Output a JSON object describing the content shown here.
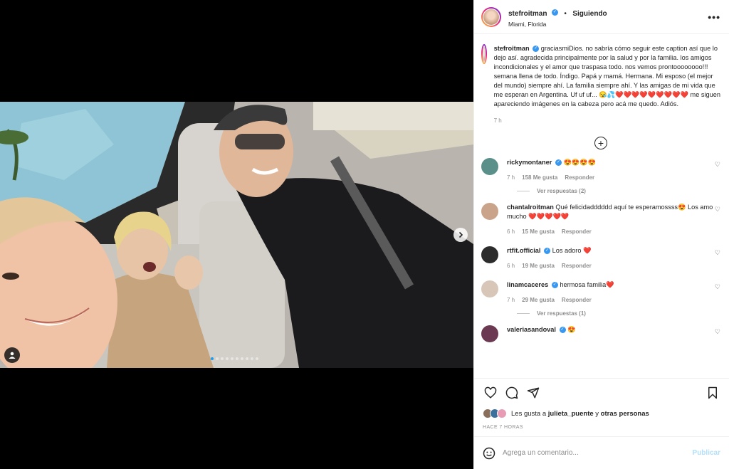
{
  "post": {
    "username": "stefroitman",
    "follow_status": "Siguiendo",
    "location": "Miami, Florida",
    "more": "•••",
    "caption": "graciasmiDios. no sabría cómo seguir este caption así que lo dejo así. agradecida principalmente por la salud y por la familia. los amigos incondicionales y el amor que traspasa todo. nos vemos prontoooooooo!!! semana llena de todo. Índigo. Papá y mamá. Hermana. Mi esposo (el mejor del mundo) siempre ahí. La familia siempre ahí. Y las amigas de mi vida que me esperan en Argentina. Uf uf uf... 😪💦❤️❤️❤️❤️❤️❤️❤️❤️❤️ me siguen apareciendo imágenes en la cabeza pero acá me quedo. Adiós.",
    "caption_time": "7 h"
  },
  "comments": [
    {
      "user": "rickymontaner",
      "verified": true,
      "text": "😍😍😍😍",
      "time": "7 h",
      "likes": "158 Me gusta",
      "reply": "Responder",
      "replies": "Ver respuestas (2)",
      "avatar_color": "#5b8f8a"
    },
    {
      "user": "chantalroitman",
      "verified": false,
      "text": "Qué felicidadddddd aquí te esperamossss😍 Los amo mucho ❤️❤️❤️❤️❤️",
      "time": "6 h",
      "likes": "15 Me gusta",
      "reply": "Responder",
      "replies": "",
      "avatar_color": "#c9a48a"
    },
    {
      "user": "rtfit.official",
      "verified": true,
      "text": "Los adoro ❤️",
      "time": "6 h",
      "likes": "19 Me gusta",
      "reply": "Responder",
      "replies": "",
      "avatar_color": "#2c2c2c"
    },
    {
      "user": "linamcaceres",
      "verified": true,
      "text": "hermosa familia❤️",
      "time": "7 h",
      "likes": "29 Me gusta",
      "reply": "Responder",
      "replies": "Ver respuestas (1)",
      "avatar_color": "#d8c7b9"
    },
    {
      "user": "valeriasandoval",
      "verified": true,
      "text": "😍",
      "time": "",
      "likes": "",
      "reply": "",
      "replies": "",
      "avatar_color": "#6b3a52"
    }
  ],
  "likes": {
    "prefix": "Les gusta a",
    "user": "julieta_puente",
    "connector": "y",
    "others": "otras personas"
  },
  "time_ago": "HACE 7 HORAS",
  "add_comment": {
    "placeholder": "Agrega un comentario...",
    "publish": "Publicar"
  },
  "carousel": {
    "total_slides": 10,
    "active_slide": 1
  },
  "colors": {
    "verified": "#3897f0",
    "heart": "#ed4956",
    "publish_disabled": "#b2dffc",
    "carousel_dot_active": "#1d9bf0"
  },
  "icons": [
    "heart-icon",
    "comment-icon",
    "share-icon",
    "bookmark-icon",
    "emoji-icon",
    "more-options-icon",
    "add-circle-icon",
    "next-arrow-icon",
    "user-tag-icon"
  ]
}
